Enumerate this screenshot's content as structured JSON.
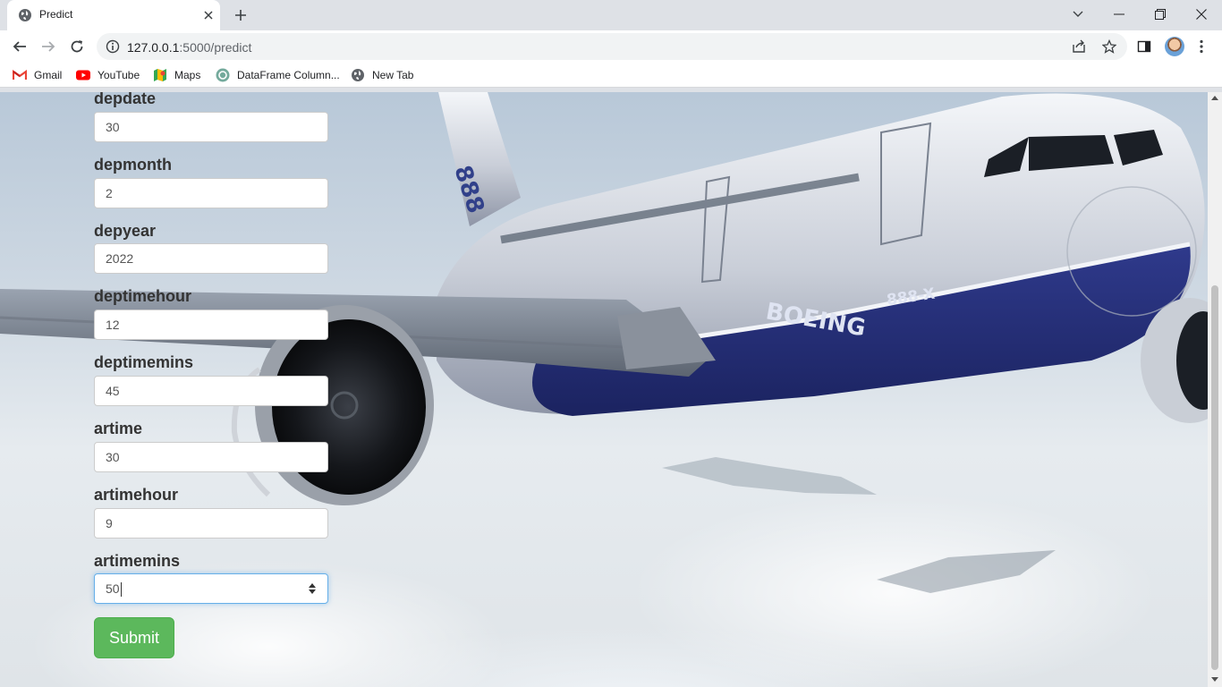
{
  "browser": {
    "tab": {
      "title": "Predict",
      "favicon": "globe-icon"
    },
    "url": {
      "host": "127.0.0.1",
      "rest": ":5000/predict"
    },
    "bookmarks": [
      {
        "label": "Gmail",
        "icon": "gmail-icon"
      },
      {
        "label": "YouTube",
        "icon": "youtube-icon"
      },
      {
        "label": "Maps",
        "icon": "maps-icon"
      },
      {
        "label": "DataFrame Column...",
        "icon": "openai-icon"
      },
      {
        "label": "New Tab",
        "icon": "globe-icon"
      }
    ]
  },
  "airplane": {
    "tail_text": "888",
    "body_text": "BOEING",
    "model_text": "888-X"
  },
  "form": {
    "fields": [
      {
        "label": "depdate",
        "value": "30"
      },
      {
        "label": "depmonth",
        "value": "2"
      },
      {
        "label": "depyear",
        "value": "2022"
      },
      {
        "label": "deptimehour",
        "value": "12"
      },
      {
        "label": "deptimemins",
        "value": "45"
      },
      {
        "label": "artime",
        "value": "30"
      },
      {
        "label": "artimehour",
        "value": "9"
      },
      {
        "label": "artimemins",
        "value": "50"
      }
    ],
    "submit_label": "Submit"
  },
  "colors": {
    "submit": "#5cb85c",
    "focus_ring": "#66afe9",
    "label": "#333333"
  }
}
